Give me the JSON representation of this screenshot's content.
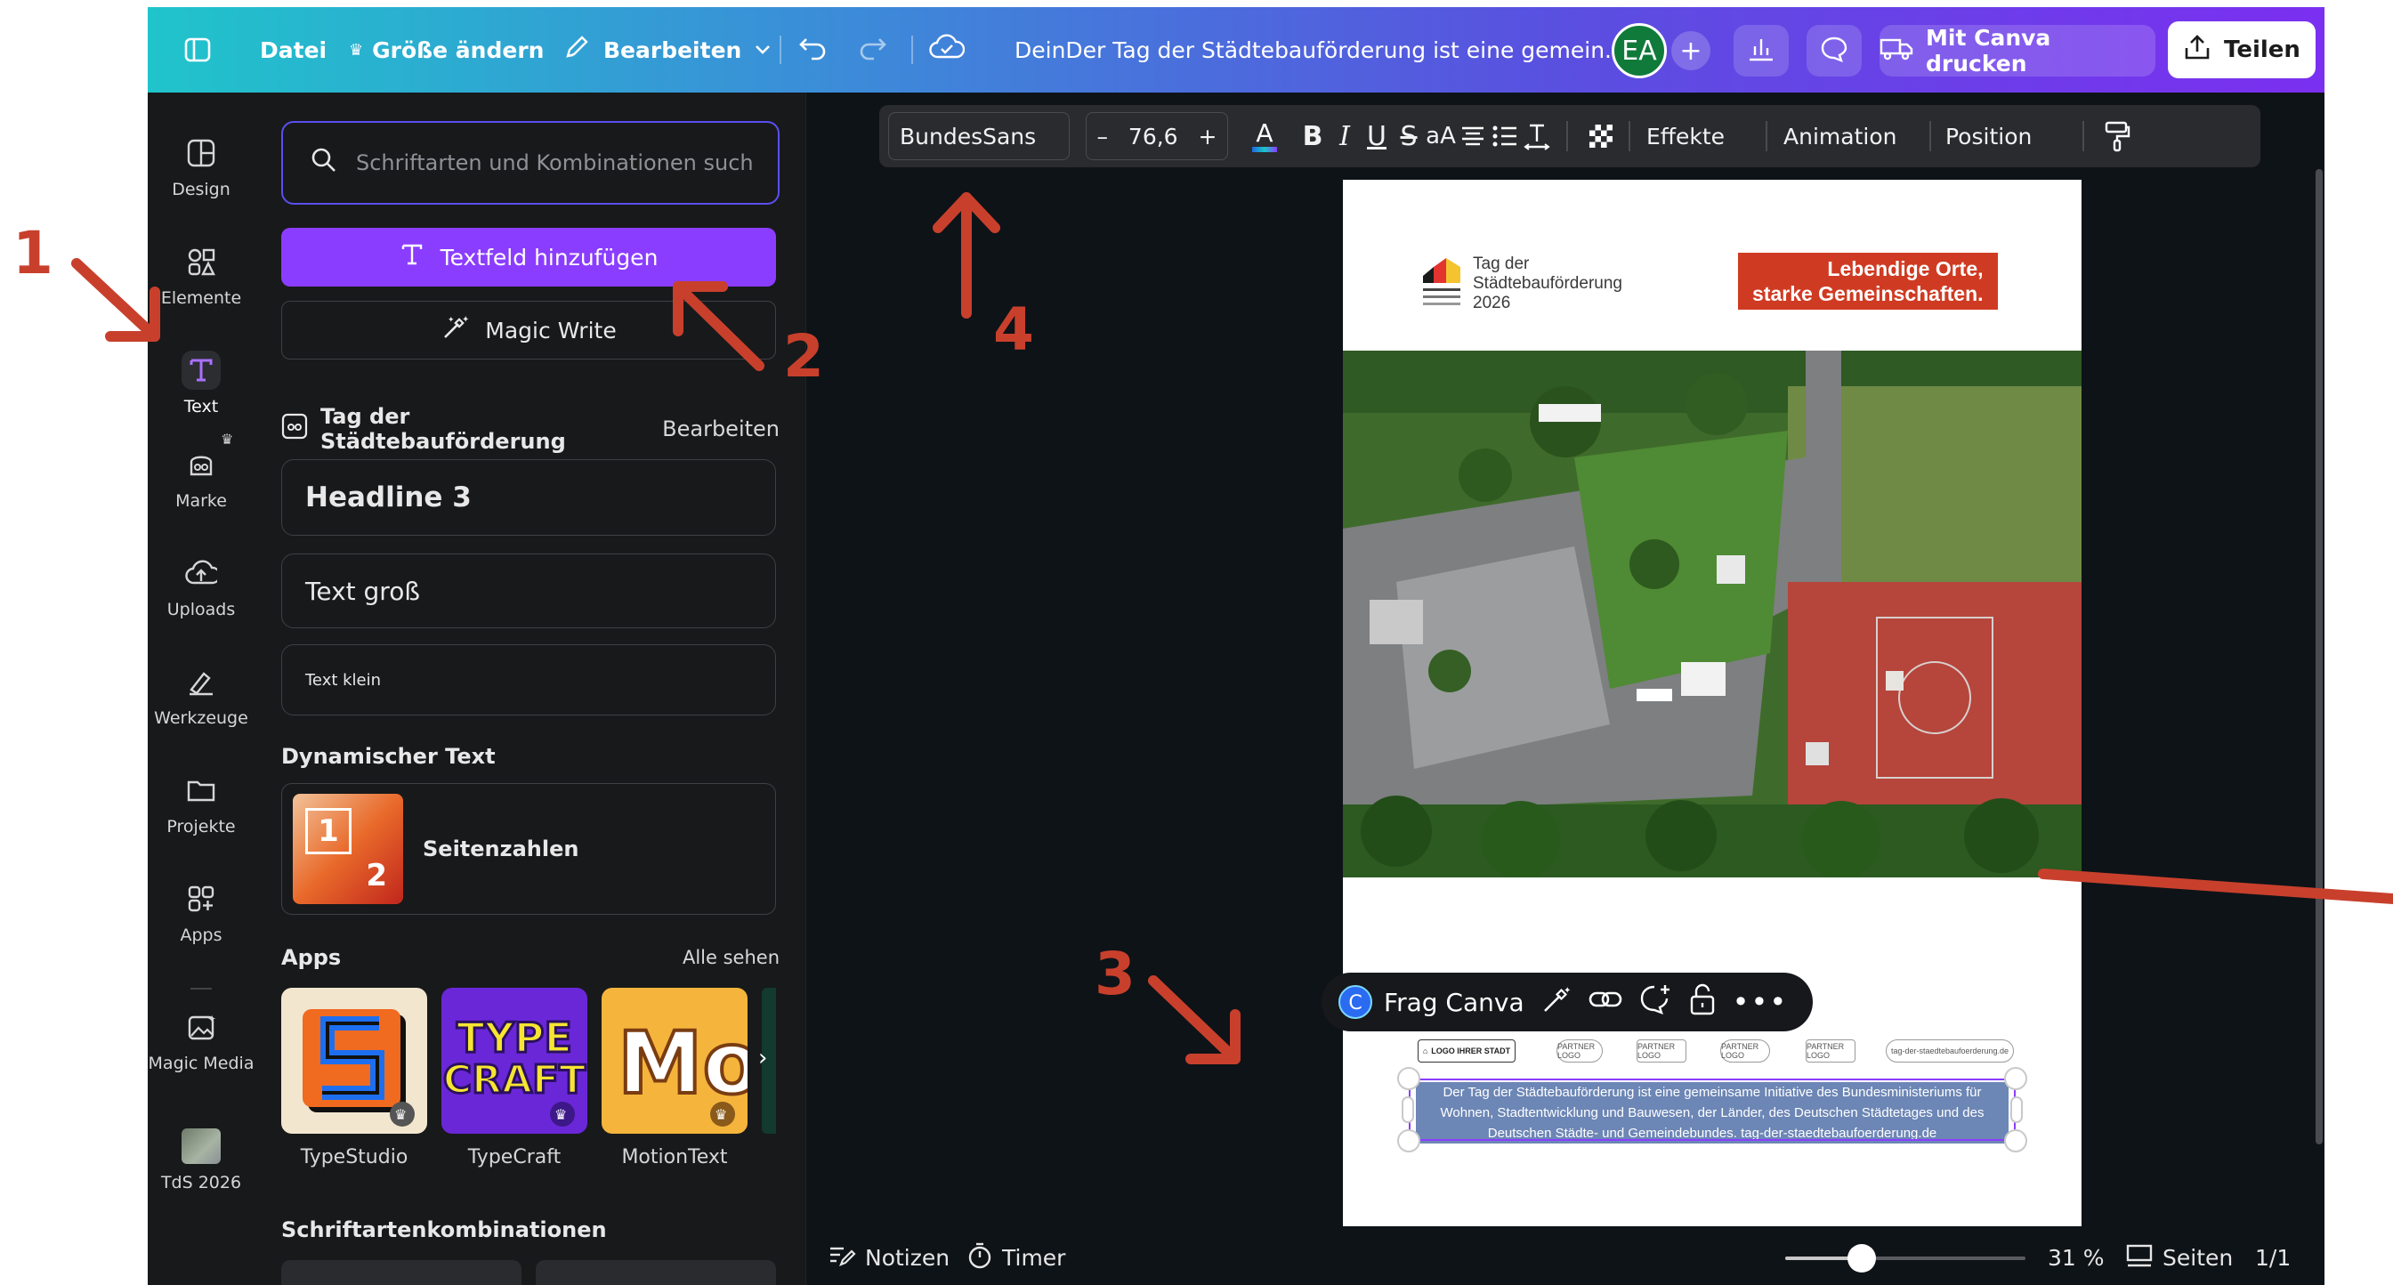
{
  "topbar": {
    "file_label": "Datei",
    "resize_label": "Größe ändern",
    "edit_label": "Bearbeiten",
    "doc_title": "DeinDer Tag der Städtebauförderung ist eine gemein...",
    "avatar_initials": "EA",
    "print_label": "Mit Canva drucken",
    "share_label": "Teilen"
  },
  "rail": {
    "items": [
      {
        "label": "Design",
        "icon": "design-icon"
      },
      {
        "label": "Elemente",
        "icon": "elements-icon"
      },
      {
        "label": "Text",
        "icon": "text-icon"
      },
      {
        "label": "Marke",
        "icon": "brand-icon"
      },
      {
        "label": "Uploads",
        "icon": "upload-icon"
      },
      {
        "label": "Werkzeuge",
        "icon": "tools-icon"
      },
      {
        "label": "Projekte",
        "icon": "folder-icon"
      },
      {
        "label": "Apps",
        "icon": "apps-icon"
      },
      {
        "label": "Magic Media",
        "icon": "magic-media-icon"
      },
      {
        "label": "TdS 2026",
        "icon": "tds-thumbnail"
      }
    ]
  },
  "panel": {
    "search_placeholder": "Schriftarten und Kombinationen such",
    "add_textbox": "Textfeld hinzufügen",
    "magic_write": "Magic Write",
    "brand_kit_title": "Tag der Städtebauförderung",
    "brand_kit_edit": "Bearbeiten",
    "headline": "Headline 3",
    "text_large": "Text groß",
    "text_small": "Text klein",
    "dynamic_heading": "Dynamischer Text",
    "page_numbers": "Seitenzahlen",
    "page_numbers_thumb_1": "1",
    "page_numbers_thumb_2": "2",
    "apps_heading": "Apps",
    "apps_see_all": "Alle sehen",
    "apps": [
      {
        "label": "TypeStudio"
      },
      {
        "label": "TypeCraft"
      },
      {
        "label": "MotionText"
      }
    ],
    "font_combos_heading": "Schriftartenkombinationen"
  },
  "format_bar": {
    "font": "BundesSans",
    "size": "76,6",
    "case_label": "aA",
    "effects": "Effekte",
    "animation": "Animation",
    "position": "Position"
  },
  "page": {
    "logo_line1": "Tag der",
    "logo_line2": "Städtebauförderung",
    "logo_line3": "2026",
    "badge_line1": "Lebendige Orte,",
    "badge_line2": "starke Gemeinschaften.",
    "logo_box": "LOGO IHRER STADT",
    "partner_1": "PARTNER LOGO",
    "partner_2": "PARTNER LOGO",
    "partner_3": "PARTNER LOGO",
    "partner_4": "PARTNER LOGO",
    "url_small": "tag-der-staedtebaufoerderung.de",
    "body_text": "Der Tag der Städtebauförderung ist eine gemeinsame Initiative des Bundesministeriums für Wohnen, Stadtentwicklung und Bauwesen, der Länder, des Deutschen Städtetages und des Deutschen Städte- und Gemeindebundes. tag-der-staedtebaufoerderung.de"
  },
  "floating_toolbar": {
    "ask_canva": "Frag Canva"
  },
  "bottom_bar": {
    "notes": "Notizen",
    "timer": "Timer",
    "zoom": "31 %",
    "zoom_level": 0.31,
    "pages": "Seiten",
    "page_count": "1/1"
  },
  "annotations": {
    "n1": "1",
    "n2": "2",
    "n3": "3",
    "n4": "4"
  },
  "colors": {
    "accent": "#8b3dff",
    "annotation": "#c8402c",
    "badge": "#cf3b22"
  }
}
